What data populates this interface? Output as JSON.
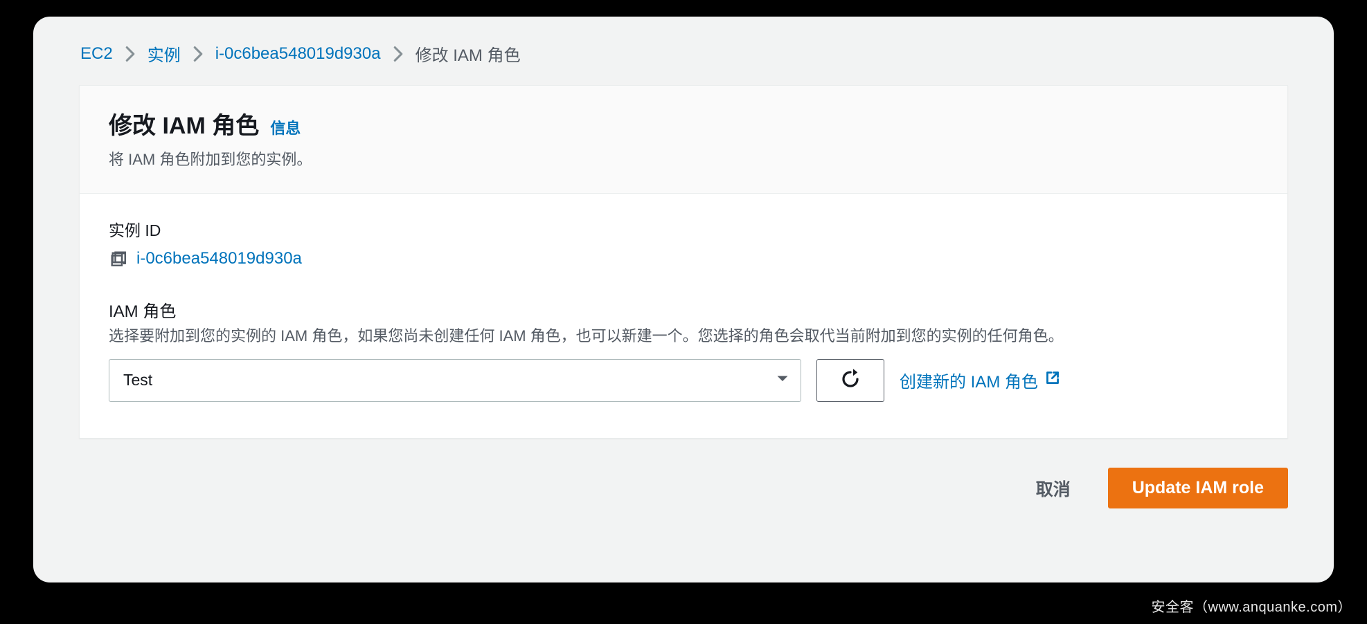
{
  "breadcrumb": {
    "items": [
      {
        "label": "EC2"
      },
      {
        "label": "实例"
      },
      {
        "label": "i-0c6bea548019d930a"
      }
    ],
    "current": "修改 IAM 角色"
  },
  "panel": {
    "title": "修改 IAM 角色",
    "info_link": "信息",
    "subtitle": "将 IAM 角色附加到您的实例。"
  },
  "instance": {
    "label": "实例 ID",
    "id": "i-0c6bea548019d930a"
  },
  "iam": {
    "label": "IAM 角色",
    "description": "选择要附加到您的实例的 IAM 角色，如果您尚未创建任何 IAM 角色，也可以新建一个。您选择的角色会取代当前附加到您的实例的任何角色。",
    "selected": "Test",
    "create_link": "创建新的 IAM 角色"
  },
  "footer": {
    "cancel": "取消",
    "update": "Update IAM role"
  },
  "watermark": "安全客（www.anquanke.com）",
  "colors": {
    "link": "#0073bb",
    "primary": "#ec7211",
    "text": "#16191f",
    "muted": "#545b64"
  }
}
